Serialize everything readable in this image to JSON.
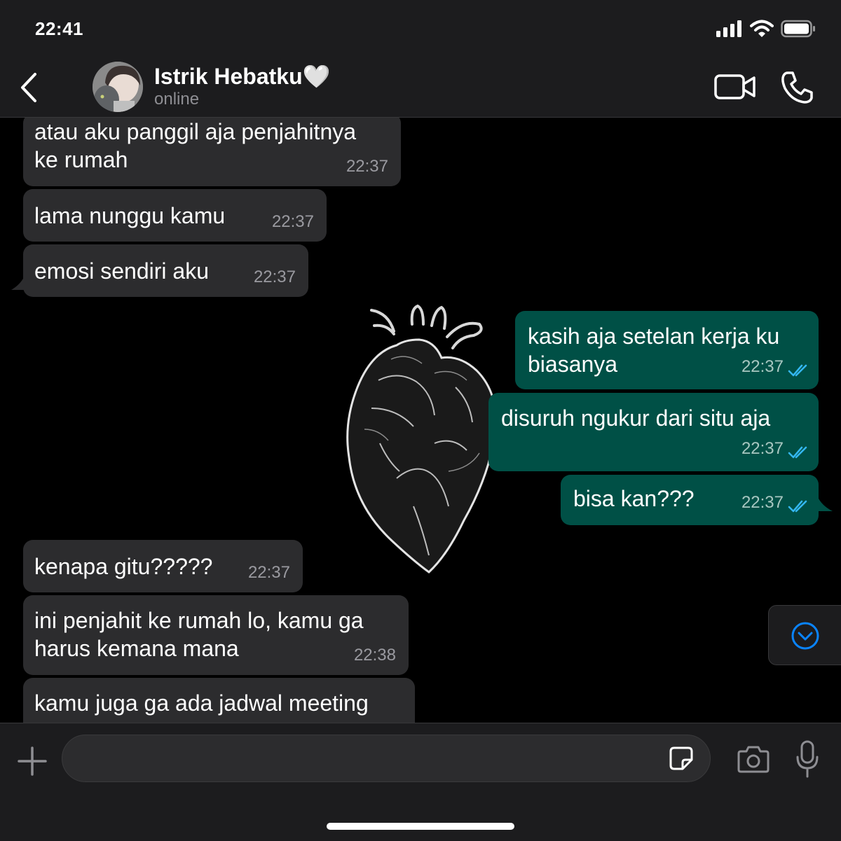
{
  "status_bar": {
    "time": "22:41",
    "icons": [
      "signal-icon",
      "wifi-icon",
      "battery-icon"
    ]
  },
  "header": {
    "contact_name": "Istrik Hebatku🤍",
    "contact_status": "online",
    "icons": [
      "back-chevron-icon",
      "video-call-icon",
      "phone-icon"
    ]
  },
  "chat": {
    "background": "heart anatomy illustration",
    "messages": [
      {
        "direction": "in",
        "text": "atau aku panggil aja penjahitnya\nke rumah",
        "time": "22:37"
      },
      {
        "direction": "in",
        "text": "lama nunggu kamu",
        "time": "22:37"
      },
      {
        "direction": "in",
        "text": "emosi sendiri aku",
        "time": "22:37"
      },
      {
        "direction": "out",
        "text": "kasih aja setelan kerja ku\nbiasanya",
        "time": "22:37",
        "status": "read"
      },
      {
        "direction": "out",
        "text": "disuruh ngukur dari situ aja",
        "time": "22:37",
        "status": "read"
      },
      {
        "direction": "out",
        "text": "bisa kan???",
        "time": "22:37",
        "status": "read"
      },
      {
        "direction": "in",
        "text": "kenapa gitu?????",
        "time": "22:37"
      },
      {
        "direction": "in",
        "text": "ini penjahit ke rumah lo, kamu ga\nharus kemana mana",
        "time": "22:38"
      },
      {
        "direction": "in",
        "text": "kamu juga ga ada jadwal meeting",
        "time": ""
      }
    ]
  },
  "composer": {
    "input_value": "",
    "icons": [
      "plus-icon",
      "sticker-icon",
      "camera-icon",
      "microphone-icon"
    ]
  },
  "colors": {
    "incoming_bubble": "#2c2c2e",
    "outgoing_bubble": "#005046",
    "read_tick": "#34b7f1",
    "accent": "#0a84ff"
  }
}
